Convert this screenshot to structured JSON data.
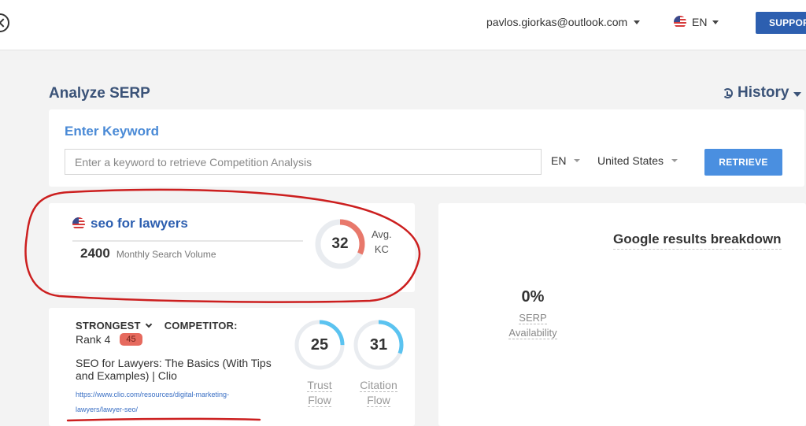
{
  "header": {
    "user_email": "pavlos.giorkas@outlook.com",
    "language": "EN",
    "support_label": "SUPPORT"
  },
  "page": {
    "title": "Analyze SERP",
    "history_label": "History"
  },
  "keyword_form": {
    "heading": "Enter Keyword",
    "placeholder": "Enter a keyword to retrieve Competition Analysis",
    "value": "",
    "language": "EN",
    "country": "United States",
    "retrieve_label": "RETRIEVE"
  },
  "summary": {
    "keyword": "seo for lawyers",
    "volume": "2400",
    "volume_label": "Monthly Search Volume",
    "kc_value": 32,
    "kc_label_line1": "Avg.",
    "kc_label_line2": "KC",
    "kc_color": "#e8786b"
  },
  "breakdown": {
    "title": "Google results breakdown",
    "serp_pct": "0%",
    "serp_label_line1": "SERP",
    "serp_label_line2": "Availability"
  },
  "competitor": {
    "strongest_label": "STRONGEST",
    "competitor_label": "COMPETITOR:",
    "rank_label": "Rank 4",
    "rank_badge": "45",
    "title": "SEO for Lawyers: The Basics (With Tips and Examples) | Clio",
    "url": "https://www.clio.com/resources/digital-marketing-lawyers/lawyer-seo/",
    "trust_flow": 25,
    "trust_label_line1": "Trust",
    "trust_label_line2": "Flow",
    "citation_flow": 31,
    "citation_label_line1": "Citation",
    "citation_label_line2": "Flow",
    "flow_color": "#5bc3f0"
  },
  "colors": {
    "accent_blue": "#4a8fe0",
    "title_blue": "#3b5378",
    "annotation_red": "#cc1f1f"
  }
}
